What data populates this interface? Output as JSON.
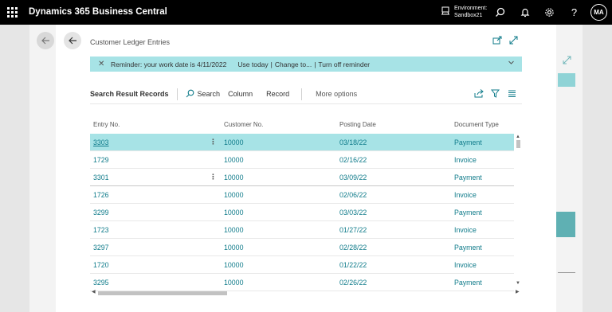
{
  "app": {
    "title": "Dynamics 365 Business Central",
    "environment_label": "Environment:",
    "environment_name": "Sandbox21",
    "user_initials": "MA"
  },
  "page": {
    "title": "Customer Ledger Entries"
  },
  "reminder": {
    "text": "Reminder: your work date is 4/11/2022",
    "use_today": "Use today",
    "change_to": "Change to...",
    "turn_off": "Turn off reminder"
  },
  "action_bar": {
    "title": "Search Result Records",
    "search": "Search",
    "column": "Column",
    "record": "Record",
    "more_options": "More options"
  },
  "grid": {
    "columns": [
      "Entry No.",
      "Customer No.",
      "Posting Date",
      "Document Type"
    ],
    "rows": [
      {
        "entry_no": "3303",
        "customer_no": "10000",
        "posting_date": "03/18/22",
        "document_type": "Payment"
      },
      {
        "entry_no": "1729",
        "customer_no": "10000",
        "posting_date": "02/16/22",
        "document_type": "Invoice"
      },
      {
        "entry_no": "3301",
        "customer_no": "10000",
        "posting_date": "03/09/22",
        "document_type": "Payment"
      },
      {
        "entry_no": "1726",
        "customer_no": "10000",
        "posting_date": "02/06/22",
        "document_type": "Invoice"
      },
      {
        "entry_no": "3299",
        "customer_no": "10000",
        "posting_date": "03/03/22",
        "document_type": "Payment"
      },
      {
        "entry_no": "1723",
        "customer_no": "10000",
        "posting_date": "01/27/22",
        "document_type": "Invoice"
      },
      {
        "entry_no": "3297",
        "customer_no": "10000",
        "posting_date": "02/28/22",
        "document_type": "Payment"
      },
      {
        "entry_no": "1720",
        "customer_no": "10000",
        "posting_date": "01/22/22",
        "document_type": "Invoice"
      },
      {
        "entry_no": "3295",
        "customer_no": "10000",
        "posting_date": "02/26/22",
        "document_type": "Payment"
      }
    ]
  },
  "colors": {
    "accent": "#0f7b8a",
    "highlight": "#a7e3e6",
    "topbar": "#000000"
  },
  "icons": {
    "waffle": "app-launcher-icon",
    "environment": "environment-icon",
    "search": "search-icon",
    "notifications": "bell-icon",
    "settings": "gear-icon",
    "help": "help-icon"
  }
}
